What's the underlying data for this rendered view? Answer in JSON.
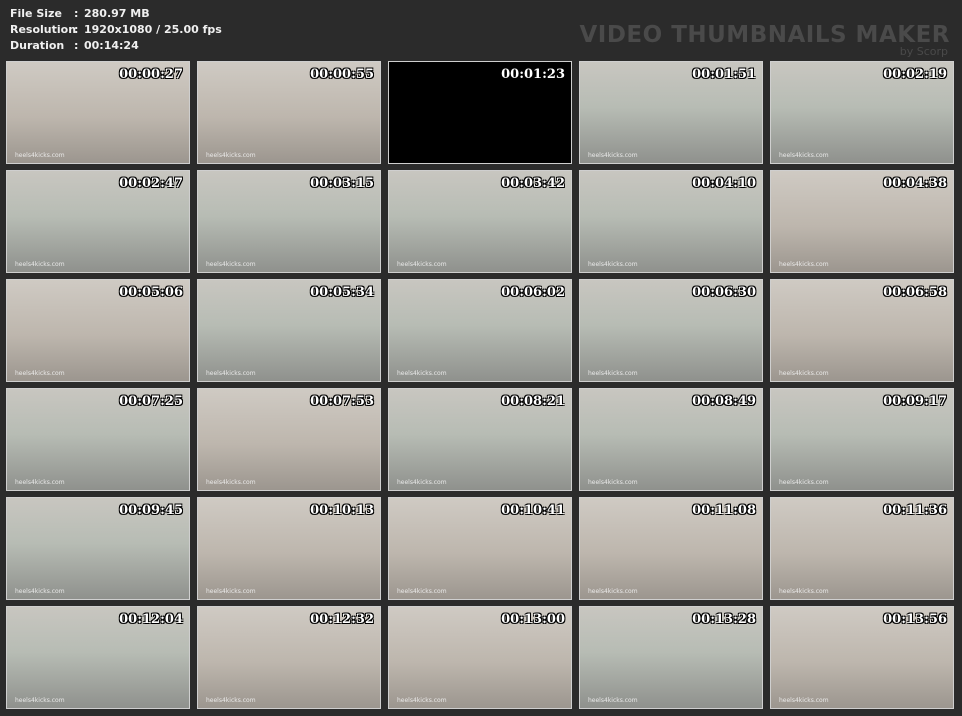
{
  "header": {
    "rows": [
      {
        "key": "File Size",
        "sep": ":",
        "value": "280.97 MB"
      },
      {
        "key": "Resolution",
        "sep": ":",
        "value": "1920x1080 / 25.00 fps"
      },
      {
        "key": "Duration",
        "sep": ":",
        "value": "00:14:24"
      }
    ],
    "brand_title": "VIDEO THUMBNAILS MAKER",
    "brand_sub": "by Scorp"
  },
  "watermark": "heels4kicks.com",
  "thumbnails": [
    {
      "time": "00:00:27",
      "scene": "room"
    },
    {
      "time": "00:00:55",
      "scene": "room"
    },
    {
      "time": "00:01:23",
      "scene": "black"
    },
    {
      "time": "00:01:51",
      "scene": "gym"
    },
    {
      "time": "00:02:19",
      "scene": "gym"
    },
    {
      "time": "00:02:47",
      "scene": "gym"
    },
    {
      "time": "00:03:15",
      "scene": "gym"
    },
    {
      "time": "00:03:42",
      "scene": "gym"
    },
    {
      "time": "00:04:10",
      "scene": "gym"
    },
    {
      "time": "00:04:38",
      "scene": "room"
    },
    {
      "time": "00:05:06",
      "scene": "room"
    },
    {
      "time": "00:05:34",
      "scene": "gym"
    },
    {
      "time": "00:06:02",
      "scene": "gym"
    },
    {
      "time": "00:06:30",
      "scene": "gym"
    },
    {
      "time": "00:06:58",
      "scene": "room"
    },
    {
      "time": "00:07:25",
      "scene": "gym"
    },
    {
      "time": "00:07:53",
      "scene": "room"
    },
    {
      "time": "00:08:21",
      "scene": "gym"
    },
    {
      "time": "00:08:49",
      "scene": "gym"
    },
    {
      "time": "00:09:17",
      "scene": "gym"
    },
    {
      "time": "00:09:45",
      "scene": "gym"
    },
    {
      "time": "00:10:13",
      "scene": "room"
    },
    {
      "time": "00:10:41",
      "scene": "room"
    },
    {
      "time": "00:11:08",
      "scene": "room"
    },
    {
      "time": "00:11:36",
      "scene": "room"
    },
    {
      "time": "00:12:04",
      "scene": "gym"
    },
    {
      "time": "00:12:32",
      "scene": "room"
    },
    {
      "time": "00:13:00",
      "scene": "room"
    },
    {
      "time": "00:13:28",
      "scene": "gym"
    },
    {
      "time": "00:13:56",
      "scene": "room"
    }
  ]
}
